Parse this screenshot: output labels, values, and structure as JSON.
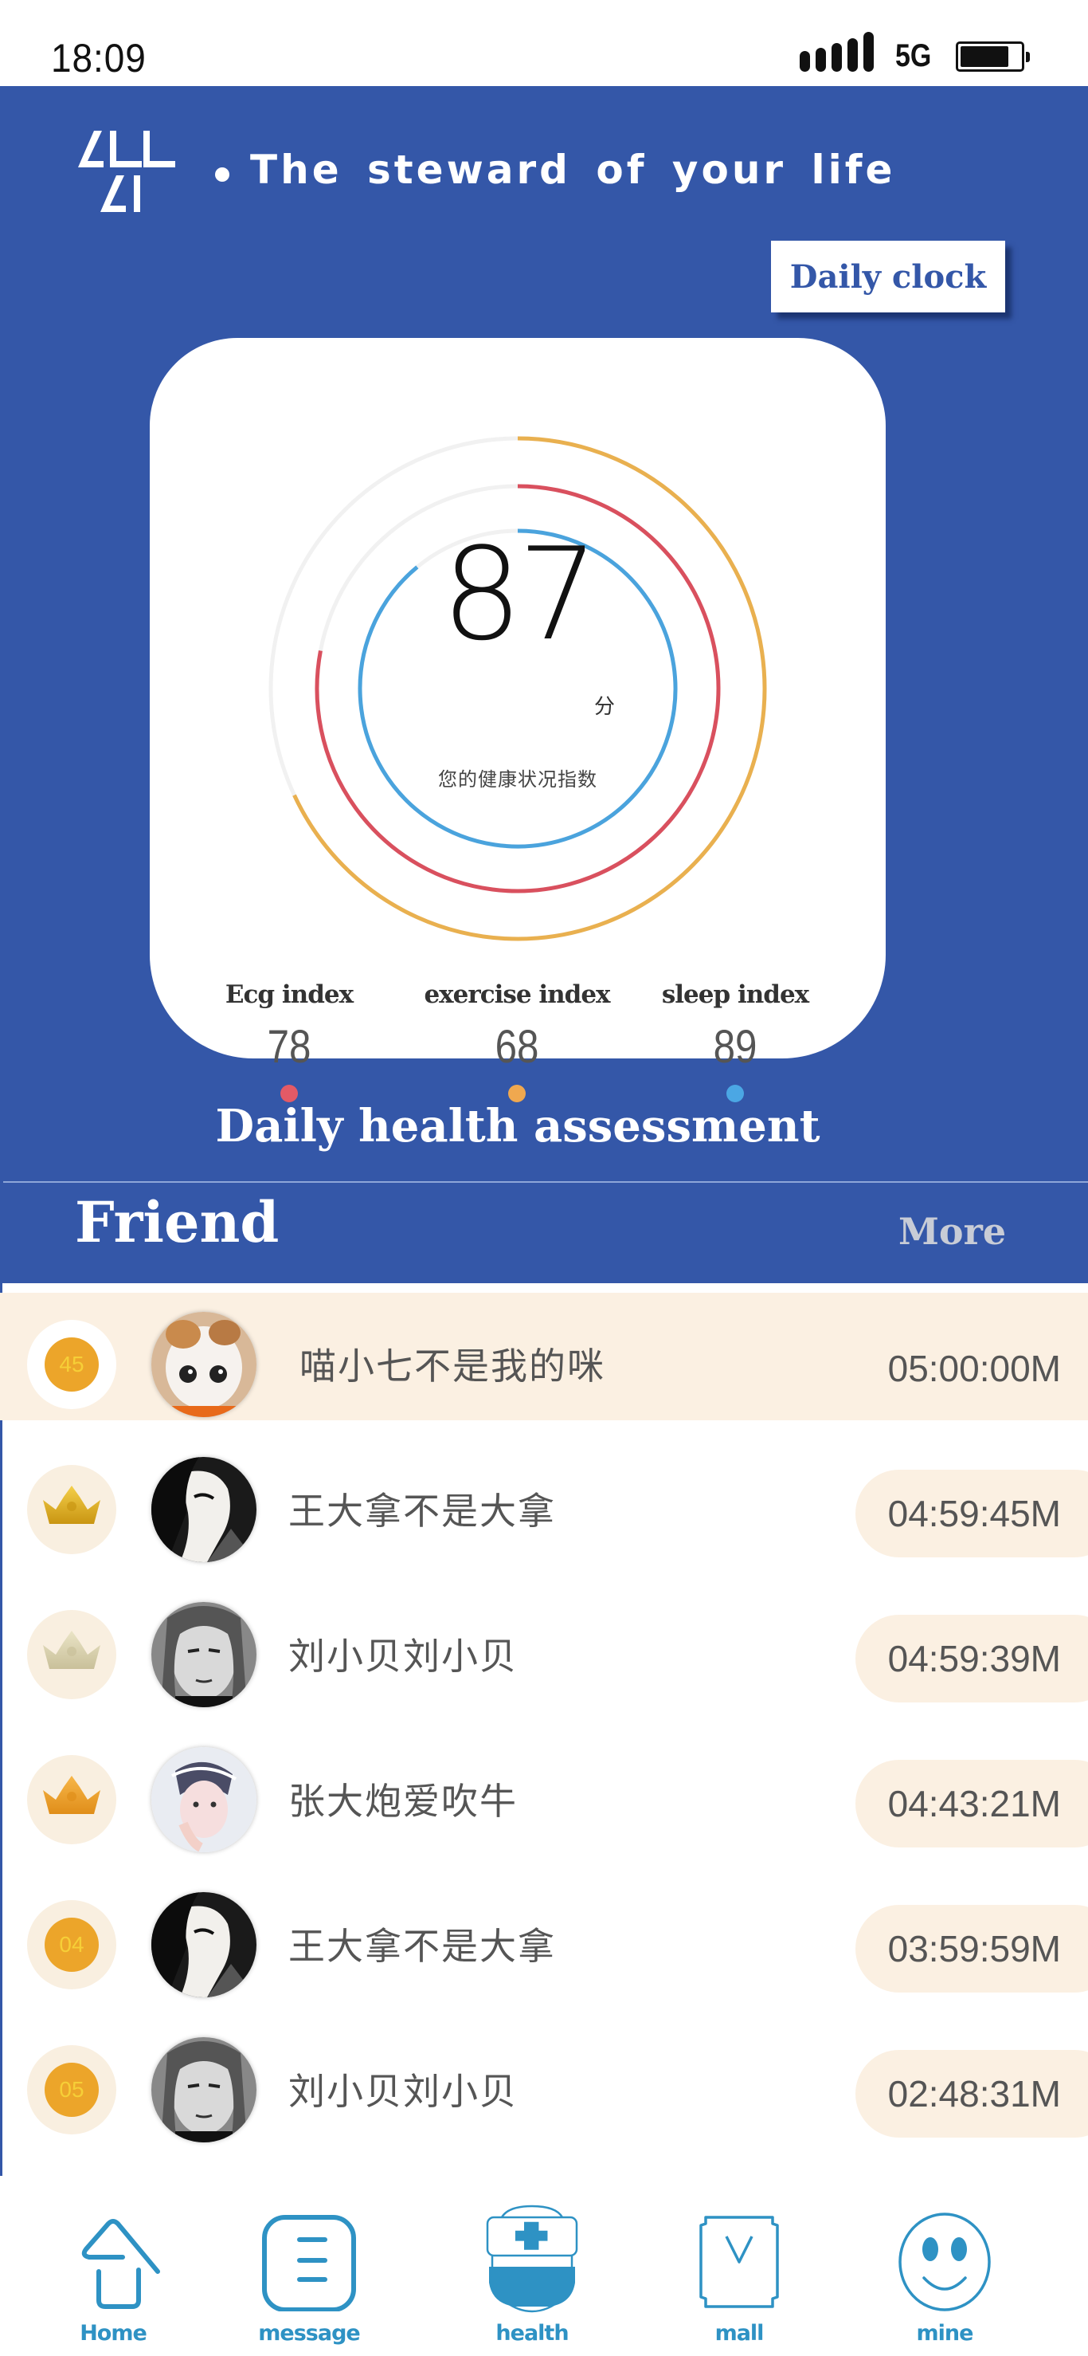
{
  "status_bar": {
    "time": "18:09",
    "network": "5G",
    "signal_bars": 5,
    "battery_level_percent": 80
  },
  "header": {
    "logo_line1": "ALL",
    "logo_line2": "AI",
    "tagline": "The steward of your life",
    "daily_clock_label": "Daily clock"
  },
  "health_score": {
    "score": "87",
    "unit": "分",
    "caption": "您的健康状况指数",
    "rings": [
      {
        "name": "exercise",
        "color": "#e9b04f",
        "value": 68
      },
      {
        "name": "ecg",
        "color": "#d9505e",
        "value": 78
      },
      {
        "name": "sleep",
        "color": "#4aa3dd",
        "value": 89
      }
    ],
    "track_color": "#f1f1f1",
    "metrics": [
      {
        "label": "Ecg index",
        "value": "78",
        "color": "#e35a66"
      },
      {
        "label": "exercise index",
        "value": "68",
        "color": "#f0a84f"
      },
      {
        "label": "sleep index",
        "value": "89",
        "color": "#4ba7e4"
      }
    ]
  },
  "assessment_title": "Daily health assessment",
  "friends": {
    "title": "Friend",
    "more_label": "More",
    "rows": [
      {
        "rank": "45",
        "rank_type": "number",
        "name": "喵小七不是我的咪",
        "time": "05:00:00M",
        "avatar": "cat",
        "highlight": true
      },
      {
        "rank": "1",
        "rank_type": "crown-gold",
        "name": "王大拿不是大拿",
        "time": "04:59:45M",
        "avatar": "anime-dark",
        "highlight": false
      },
      {
        "rank": "2",
        "rank_type": "crown-silver",
        "name": "刘小贝刘小贝",
        "time": "04:59:39M",
        "avatar": "man-bw",
        "highlight": false
      },
      {
        "rank": "3",
        "rank_type": "crown-bronze",
        "name": "张大炮爱吹牛",
        "time": "04:43:21M",
        "avatar": "girl-light",
        "highlight": false
      },
      {
        "rank": "04",
        "rank_type": "number",
        "name": "王大拿不是大拿",
        "time": "03:59:59M",
        "avatar": "anime-dark",
        "highlight": false
      },
      {
        "rank": "05",
        "rank_type": "number",
        "name": "刘小贝刘小贝",
        "time": "02:48:31M",
        "avatar": "man-bw",
        "highlight": false
      }
    ]
  },
  "bottom_nav": {
    "accent_color": "#2e92c4",
    "items": [
      {
        "label": "Home",
        "icon": "home-icon"
      },
      {
        "label": "message",
        "icon": "message-icon"
      },
      {
        "label": "health",
        "icon": "health-icon",
        "active": true
      },
      {
        "label": "mall",
        "icon": "mall-icon"
      },
      {
        "label": "mine",
        "icon": "mine-icon"
      }
    ]
  }
}
